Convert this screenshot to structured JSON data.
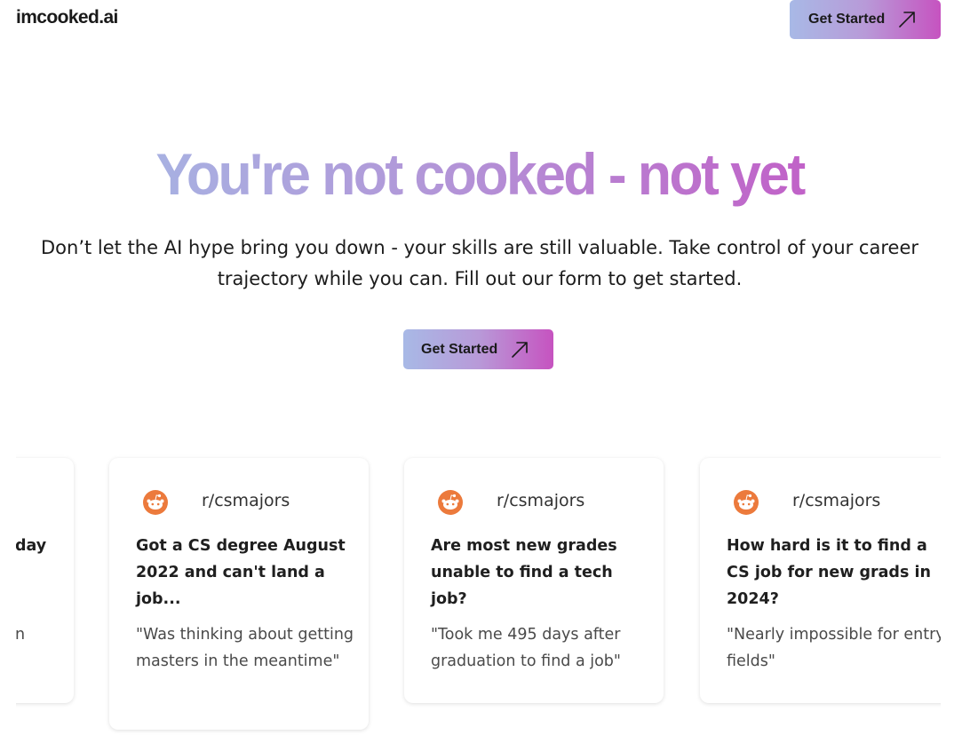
{
  "header": {
    "logo": "imcooked.ai",
    "cta_label": "Get Started"
  },
  "hero": {
    "title": "You're not cooked - not yet",
    "subtitle": "Don’t let the AI hype bring you down - your skills are still valuable. Take control of your career trajectory while you can. Fill out our form to get started.",
    "cta_label": "Get Started"
  },
  "cards": [
    {
      "subreddit": "",
      "title": "day",
      "quote": "n"
    },
    {
      "subreddit": "r/csmajors",
      "title": "Got a CS degree August 2022 and can't land a job...",
      "quote": "\"Was thinking about getting masters in the meantime\""
    },
    {
      "subreddit": "r/csmajors",
      "title": "Are most new grades unable to find a tech job?",
      "quote": "\"Took me 495 days after graduation to find a job\""
    },
    {
      "subreddit": "r/csmajors",
      "title": "How hard is it to find a CS job for new grads in 2024?",
      "quote": "\"Nearly impossible for entry fields\""
    }
  ],
  "icons": {
    "arrow": "arrow-up-right-icon",
    "reddit": "reddit-icon"
  },
  "colors": {
    "gradient_start": "#a8b9e6",
    "gradient_mid": "#b89ad8",
    "gradient_end": "#c653c0",
    "reddit_orange": "#ec7a3c"
  }
}
